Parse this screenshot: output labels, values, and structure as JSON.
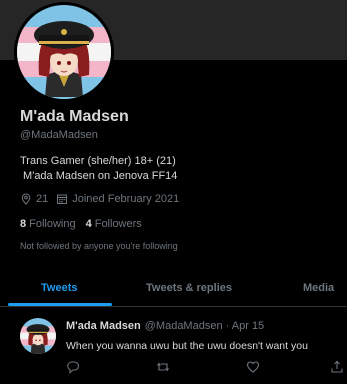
{
  "profile": {
    "name": "M'ada Madsen",
    "handle": "@MadaMadsen",
    "bio_line1": "Trans Gamer (she/her) 18+ (21)",
    "bio_line2": " M'ada Madsen on Jenova FF14",
    "location": "21",
    "joined": "Joined February 2021",
    "following_count": "8",
    "following_label": "Following",
    "followers_count": "4",
    "followers_label": "Followers",
    "not_followed_note": "Not followed by anyone you're following",
    "avatar_icon": "avatar-anime-girl-cap-icon"
  },
  "tabs": [
    {
      "label": "Tweets",
      "active": true
    },
    {
      "label": "Tweets & replies",
      "active": false
    },
    {
      "label": "Media",
      "active": false
    }
  ],
  "tweet": {
    "author_name": "M'ada Madsen",
    "author_handle": "@MadaMadsen",
    "separator": "·",
    "date": "Apr 15",
    "text": "When you wanna uwu but the uwu doesn't want you"
  },
  "colors": {
    "background": "#000000",
    "banner": "#262626",
    "accent": "#1d9bf0",
    "muted": "#6e767d",
    "text": "#d9d9d9",
    "divider": "#2f3336"
  }
}
